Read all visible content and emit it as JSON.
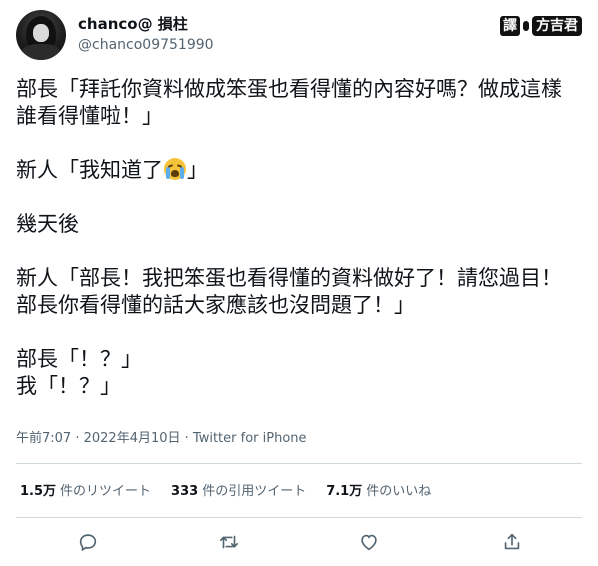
{
  "user": {
    "display_name": "chanco@ 損柱",
    "handle": "@chanco09751990",
    "avatar_icon": "avatar-icon"
  },
  "watermark": {
    "box_char": "譯",
    "name": "方吉君"
  },
  "tweet": {
    "line1": "部長「拜託你資料做成笨蛋也看得懂的內容好嗎？做成這樣誰看得懂啦！」",
    "line2_before": "新人「我知道了",
    "line2_emoji": "loudly-crying-face-emoji",
    "line2_after": "」",
    "line3": "幾天後",
    "line4": "新人「部長！我把笨蛋也看得懂的資料做好了！請您過目！部長你看得懂的話大家應該也沒問題了！」",
    "line5": "部長「！？」",
    "line6": "我「！？」"
  },
  "meta": {
    "time": "午前7:07",
    "separator1": " · ",
    "date": "2022年4月10日",
    "separator2": " · ",
    "source": "Twitter for iPhone"
  },
  "stats": {
    "retweets": {
      "num": "1.5万",
      "label": "件のリツイート"
    },
    "quotes": {
      "num": "333",
      "label": "件の引用ツイート"
    },
    "likes": {
      "num": "7.1万",
      "label": "件のいいね"
    }
  },
  "actions": {
    "reply_icon": "reply-icon",
    "retweet_icon": "retweet-icon",
    "like_icon": "heart-icon",
    "share_icon": "share-icon"
  },
  "colors": {
    "text": "#0f1419",
    "secondary": "#536471",
    "divider": "#cfd9de"
  }
}
